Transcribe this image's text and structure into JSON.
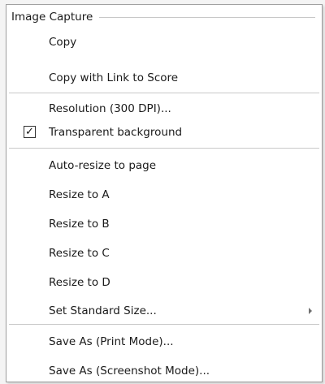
{
  "menu": {
    "header": "Image Capture",
    "items": [
      {
        "label": "Copy"
      },
      {
        "label": "Copy with Link to Score"
      },
      {
        "label": "Resolution (300 DPI)..."
      },
      {
        "label": "Transparent background",
        "checked": true
      },
      {
        "label": "Auto-resize to page"
      },
      {
        "label": "Resize to A"
      },
      {
        "label": "Resize to B"
      },
      {
        "label": "Resize to C"
      },
      {
        "label": "Resize to D"
      },
      {
        "label": "Set Standard Size...",
        "submenu": true
      },
      {
        "label": "Save As (Print Mode)..."
      },
      {
        "label": "Save As (Screenshot Mode)..."
      }
    ],
    "checkmark": "✓",
    "icons": {
      "checkbox": "checkbox-icon",
      "submenu_arrow": "chevron-right-icon"
    },
    "colors": {
      "background": "#ffffff",
      "border": "#a0a0a0",
      "separator": "#c8c8c8",
      "text": "#1a1a1a"
    }
  }
}
